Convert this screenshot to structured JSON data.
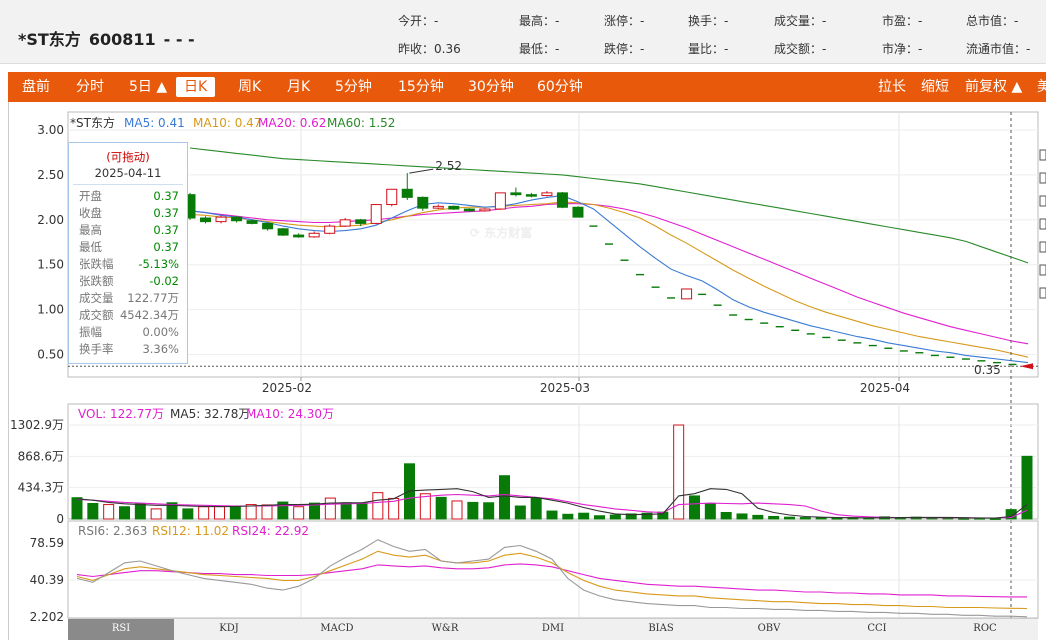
{
  "header": {
    "title": "*ST东方",
    "code": "600811",
    "dashes": "-  -  -",
    "quotes": [
      {
        "label": "今开",
        "value": "-"
      },
      {
        "label": "最高",
        "value": "-"
      },
      {
        "label": "涨停",
        "value": "-"
      },
      {
        "label": "换手",
        "value": "-"
      },
      {
        "label": "成交量",
        "value": "-"
      },
      {
        "label": "市盈",
        "value": "-"
      },
      {
        "label": "总市值",
        "value": "-"
      },
      {
        "label": "昨收",
        "value": "0.36"
      },
      {
        "label": "最低",
        "value": "-"
      },
      {
        "label": "跌停",
        "value": "-"
      },
      {
        "label": "量比",
        "value": "-"
      },
      {
        "label": "成交额",
        "value": "-"
      },
      {
        "label": "市净",
        "value": "-"
      },
      {
        "label": "流通市值",
        "value": "-"
      }
    ]
  },
  "toolbar": {
    "items": [
      "盘前",
      "分时",
      "5日 ▲",
      "日K",
      "周K",
      "月K",
      "5分钟",
      "15分钟",
      "30分钟",
      "60分钟"
    ],
    "active": "日K",
    "right_items": [
      "拉长",
      "缩短",
      "前复权 ▲",
      "美"
    ]
  },
  "kline": {
    "legend_name": "*ST东方",
    "ma": [
      {
        "label": "MA5: 0.41",
        "color": "#3a7bd5"
      },
      {
        "label": "MA10: 0.47",
        "color": "#d79a1a"
      },
      {
        "label": "MA20: 0.62",
        "color": "#e020d0"
      },
      {
        "label": "MA60: 1.52",
        "color": "#2a8a2a"
      }
    ],
    "y_ticks": [
      "3.00",
      "2.50",
      "2.00",
      "1.50",
      "1.00",
      "0.50"
    ],
    "x_ticks": [
      "2025-02",
      "2025-03",
      "2025-04"
    ],
    "high_annotation": "2.52",
    "last_price": "0.35",
    "watermark": "东方财富"
  },
  "tooltip": {
    "drag": "(可拖动)",
    "date": "2025-04-11",
    "rows": [
      {
        "k": "开盘",
        "v": "0.37",
        "tone": "green"
      },
      {
        "k": "收盘",
        "v": "0.37",
        "tone": "green"
      },
      {
        "k": "最高",
        "v": "0.37",
        "tone": "green"
      },
      {
        "k": "最低",
        "v": "0.37",
        "tone": "green"
      },
      {
        "k": "张跌幅",
        "v": "-5.13%",
        "tone": "green"
      },
      {
        "k": "张跌额",
        "v": "-0.02",
        "tone": "green"
      },
      {
        "k": "成交量",
        "v": "122.77万",
        "tone": "gray"
      },
      {
        "k": "成交额",
        "v": "4542.34万",
        "tone": "gray"
      },
      {
        "k": "振幅",
        "v": "0.00%",
        "tone": "gray"
      },
      {
        "k": "换手率",
        "v": "3.36%",
        "tone": "gray"
      }
    ]
  },
  "volume": {
    "legend": [
      {
        "label": "VOL: 122.77万",
        "color": "#e020d0"
      },
      {
        "label": "MA5: 32.78万",
        "color": "#333333"
      },
      {
        "label": "MA10: 24.30万",
        "color": "#e020d0"
      }
    ],
    "y_ticks": [
      "1302.9万",
      "868.6万",
      "434.3万",
      "0"
    ]
  },
  "rsi": {
    "legend": [
      {
        "label": "RSI6: 2.363",
        "color": "#777777"
      },
      {
        "label": "RSI12: 11.02",
        "color": "#d79a1a"
      },
      {
        "label": "RSI24: 22.92",
        "color": "#e020d0"
      }
    ],
    "y_ticks": [
      "78.59",
      "40.39",
      "2.202"
    ]
  },
  "indicator_tabs": [
    "RSI",
    "KDJ",
    "MACD",
    "W&R",
    "DMI",
    "BIAS",
    "OBV",
    "CCI",
    "ROC"
  ],
  "active_indicator": "RSI",
  "chart_data": [
    {
      "type": "candlestick",
      "x_ticks": [
        "2025-02",
        "2025-03",
        "2025-04"
      ],
      "ylim": [
        0.25,
        3.0
      ],
      "candles": [
        [
          2.28,
          2.02,
          2.3,
          2.0
        ],
        [
          2.02,
          1.98,
          2.04,
          1.96
        ],
        [
          1.98,
          2.03,
          2.05,
          1.96
        ],
        [
          2.03,
          1.99,
          2.04,
          1.97
        ],
        [
          1.99,
          1.96,
          2.0,
          1.95
        ],
        [
          1.96,
          1.9,
          1.97,
          1.88
        ],
        [
          1.9,
          1.83,
          1.91,
          1.82
        ],
        [
          1.83,
          1.81,
          1.85,
          1.8
        ],
        [
          1.81,
          1.85,
          1.87,
          1.8
        ],
        [
          1.85,
          1.93,
          1.95,
          1.84
        ],
        [
          1.93,
          2.0,
          2.02,
          1.92
        ],
        [
          2.0,
          1.96,
          2.01,
          1.93
        ],
        [
          1.96,
          2.17,
          2.17,
          1.95
        ],
        [
          2.17,
          2.34,
          2.34,
          2.15
        ],
        [
          2.34,
          2.25,
          2.52,
          2.22
        ],
        [
          2.25,
          2.13,
          2.26,
          2.1
        ],
        [
          2.13,
          2.15,
          2.17,
          2.12
        ],
        [
          2.15,
          2.12,
          2.16,
          2.11
        ],
        [
          2.12,
          2.1,
          2.13,
          2.09
        ],
        [
          2.1,
          2.12,
          2.13,
          2.09
        ],
        [
          2.12,
          2.3,
          2.3,
          2.11
        ],
        [
          2.3,
          2.28,
          2.36,
          2.26
        ],
        [
          2.28,
          2.27,
          2.3,
          2.25
        ],
        [
          2.27,
          2.3,
          2.32,
          2.26
        ],
        [
          2.3,
          2.14,
          2.31,
          2.13
        ],
        [
          2.14,
          2.03,
          2.15,
          2.03
        ],
        [
          1.93,
          1.93,
          1.93,
          1.93
        ],
        [
          1.73,
          1.73,
          1.73,
          1.73
        ],
        [
          1.55,
          1.55,
          1.55,
          1.55
        ],
        [
          1.39,
          1.39,
          1.39,
          1.39
        ],
        [
          1.25,
          1.25,
          1.25,
          1.25
        ],
        [
          1.13,
          1.13,
          1.13,
          1.13
        ],
        [
          1.12,
          1.23,
          1.23,
          1.12
        ],
        [
          1.17,
          1.17,
          1.17,
          1.17
        ],
        [
          1.05,
          1.05,
          1.05,
          1.05
        ],
        [
          0.94,
          0.94,
          0.94,
          0.94
        ],
        [
          0.89,
          0.89,
          0.89,
          0.89
        ],
        [
          0.85,
          0.85,
          0.85,
          0.85
        ],
        [
          0.81,
          0.81,
          0.81,
          0.81
        ],
        [
          0.77,
          0.77,
          0.77,
          0.77
        ],
        [
          0.73,
          0.73,
          0.73,
          0.73
        ],
        [
          0.69,
          0.69,
          0.69,
          0.69
        ],
        [
          0.66,
          0.66,
          0.66,
          0.66
        ],
        [
          0.63,
          0.63,
          0.63,
          0.63
        ],
        [
          0.6,
          0.6,
          0.6,
          0.6
        ],
        [
          0.57,
          0.57,
          0.57,
          0.57
        ],
        [
          0.54,
          0.54,
          0.54,
          0.54
        ],
        [
          0.52,
          0.52,
          0.52,
          0.52
        ],
        [
          0.49,
          0.49,
          0.49,
          0.49
        ],
        [
          0.47,
          0.47,
          0.47,
          0.47
        ],
        [
          0.45,
          0.45,
          0.45,
          0.45
        ],
        [
          0.43,
          0.43,
          0.43,
          0.43
        ],
        [
          0.41,
          0.41,
          0.41,
          0.41
        ],
        [
          0.39,
          0.39,
          0.39,
          0.39
        ],
        [
          0.37,
          0.37,
          0.37,
          0.37
        ]
      ],
      "ma5": [
        2.1,
        2.08,
        2.05,
        2.03,
        2.0,
        1.97,
        1.93,
        1.9,
        1.88,
        1.87,
        1.88,
        1.9,
        1.94,
        2.02,
        2.1,
        2.17,
        2.19,
        2.18,
        2.16,
        2.14,
        2.15,
        2.18,
        2.22,
        2.25,
        2.27,
        2.2,
        2.12,
        1.98,
        1.84,
        1.7,
        1.57,
        1.45,
        1.38,
        1.32,
        1.22,
        1.11,
        1.03,
        0.97,
        0.92,
        0.87,
        0.82,
        0.78,
        0.74,
        0.7,
        0.67,
        0.63,
        0.6,
        0.57,
        0.54,
        0.52,
        0.49,
        0.47,
        0.45,
        0.43,
        0.41
      ],
      "ma10": [
        2.06,
        2.05,
        2.03,
        2.02,
        2.0,
        1.98,
        1.96,
        1.94,
        1.93,
        1.92,
        1.93,
        1.94,
        1.97,
        2.0,
        2.04,
        2.08,
        2.11,
        2.13,
        2.14,
        2.14,
        2.15,
        2.16,
        2.17,
        2.18,
        2.2,
        2.19,
        2.17,
        2.13,
        2.08,
        2.02,
        1.93,
        1.83,
        1.74,
        1.64,
        1.54,
        1.44,
        1.35,
        1.26,
        1.18,
        1.1,
        1.03,
        0.97,
        0.92,
        0.87,
        0.82,
        0.78,
        0.74,
        0.7,
        0.67,
        0.64,
        0.61,
        0.58,
        0.55,
        0.51,
        0.47
      ],
      "ma20": [
        2.1,
        2.08,
        2.06,
        2.04,
        2.02,
        2.0,
        1.99,
        1.98,
        1.97,
        1.97,
        1.98,
        1.99,
        2.0,
        2.02,
        2.04,
        2.06,
        2.07,
        2.08,
        2.09,
        2.1,
        2.12,
        2.14,
        2.15,
        2.17,
        2.18,
        2.18,
        2.17,
        2.15,
        2.12,
        2.08,
        2.03,
        1.97,
        1.91,
        1.84,
        1.77,
        1.7,
        1.63,
        1.56,
        1.49,
        1.42,
        1.35,
        1.28,
        1.21,
        1.14,
        1.08,
        1.02,
        0.96,
        0.91,
        0.86,
        0.81,
        0.77,
        0.73,
        0.69,
        0.65,
        0.62
      ],
      "ma60": [
        2.8,
        2.78,
        2.76,
        2.74,
        2.72,
        2.7,
        2.68,
        2.67,
        2.66,
        2.65,
        2.64,
        2.63,
        2.62,
        2.61,
        2.6,
        2.59,
        2.58,
        2.57,
        2.56,
        2.55,
        2.54,
        2.53,
        2.52,
        2.51,
        2.5,
        2.48,
        2.46,
        2.44,
        2.42,
        2.4,
        2.37,
        2.34,
        2.31,
        2.28,
        2.25,
        2.22,
        2.19,
        2.16,
        2.13,
        2.1,
        2.07,
        2.04,
        2.01,
        1.98,
        1.95,
        1.92,
        1.89,
        1.86,
        1.83,
        1.8,
        1.76,
        1.7,
        1.64,
        1.58,
        1.52
      ]
    },
    {
      "type": "bar",
      "ylim": [
        0,
        1302.9
      ],
      "unit": "万",
      "volume": [
        295,
        215,
        200,
        170,
        210,
        140,
        225,
        140,
        170,
        180,
        175,
        200,
        195,
        235,
        170,
        220,
        290,
        225,
        220,
        365,
        285,
        765,
        350,
        300,
        250,
        230,
        225,
        600,
        180,
        290,
        110,
        65,
        80,
        45,
        55,
        70,
        80,
        95,
        1302.9,
        320,
        210,
        90,
        70,
        50,
        35,
        25,
        20,
        15,
        12,
        18,
        14,
        30,
        20,
        25,
        20,
        15,
        10,
        12,
        8,
        130,
        868.6
      ],
      "ma5": [
        280,
        260,
        230,
        210,
        200,
        190,
        190,
        180,
        175,
        170,
        175,
        180,
        190,
        200,
        200,
        205,
        220,
        225,
        225,
        260,
        280,
        390,
        400,
        410,
        420,
        380,
        300,
        320,
        300,
        300,
        260,
        220,
        160,
        110,
        70,
        60,
        65,
        70,
        320,
        350,
        420,
        410,
        350,
        150,
        90,
        55,
        35,
        25,
        20,
        18,
        16,
        18,
        20,
        22,
        22,
        22,
        18,
        14,
        12,
        35,
        200
      ],
      "ma10": [
        270,
        260,
        245,
        230,
        220,
        210,
        200,
        195,
        190,
        185,
        180,
        180,
        182,
        185,
        190,
        195,
        205,
        210,
        215,
        230,
        245,
        290,
        310,
        330,
        340,
        330,
        320,
        340,
        320,
        300,
        280,
        240,
        200,
        170,
        140,
        120,
        100,
        90,
        200,
        210,
        220,
        215,
        210,
        220,
        210,
        200,
        180,
        110,
        60,
        40,
        30,
        22,
        20,
        20,
        18,
        18,
        16,
        15,
        14,
        22,
        120
      ]
    },
    {
      "type": "line",
      "ylim": [
        2.202,
        78.59
      ],
      "rsi6": [
        42,
        38,
        48,
        58,
        60,
        55,
        50,
        46,
        42,
        40,
        38,
        36,
        32,
        30,
        34,
        42,
        55,
        64,
        72,
        82,
        75,
        70,
        72,
        60,
        58,
        60,
        62,
        74,
        76,
        70,
        62,
        42,
        30,
        24,
        20,
        18,
        16,
        15,
        14,
        14,
        12,
        12,
        11,
        11,
        10,
        10,
        9,
        9,
        8,
        8,
        7,
        7,
        6,
        6,
        5,
        5,
        4,
        4,
        3,
        3,
        2.4
      ],
      "rsi12": [
        44,
        40,
        46,
        52,
        54,
        52,
        50,
        48,
        46,
        45,
        44,
        43,
        42,
        40,
        40,
        44,
        50,
        56,
        62,
        70,
        66,
        64,
        66,
        60,
        58,
        58,
        60,
        66,
        68,
        64,
        58,
        48,
        40,
        34,
        30,
        28,
        26,
        25,
        24,
        24,
        22,
        21,
        20,
        19,
        18,
        18,
        17,
        16,
        16,
        15,
        15,
        14,
        14,
        13,
        13,
        12,
        12,
        12,
        11.5,
        11.2,
        11
      ],
      "rsi24": [
        46,
        44,
        46,
        48,
        50,
        50,
        49,
        48,
        47,
        47,
        46,
        46,
        45,
        45,
        45,
        46,
        48,
        50,
        52,
        56,
        55,
        54,
        55,
        53,
        52,
        52,
        53,
        56,
        57,
        56,
        54,
        50,
        46,
        42,
        40,
        38,
        36,
        35,
        34,
        34,
        33,
        32,
        31,
        30,
        30,
        29,
        28,
        28,
        27,
        27,
        26,
        26,
        25,
        25,
        25,
        24,
        24,
        23.5,
        23.2,
        23,
        22.9
      ]
    }
  ]
}
